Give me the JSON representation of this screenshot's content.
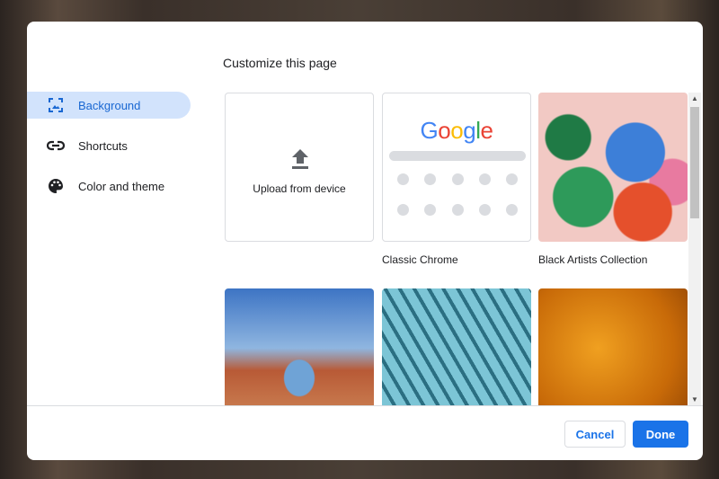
{
  "title": "Customize this page",
  "sidebar": {
    "items": [
      {
        "label": "Background",
        "icon": "image-icon",
        "active": true
      },
      {
        "label": "Shortcuts",
        "icon": "link-icon"
      },
      {
        "label": "Color and theme",
        "icon": "palette-icon"
      }
    ]
  },
  "tiles": {
    "upload": "Upload from device",
    "classic": "Classic Chrome",
    "google_logo": "Google",
    "black_artists": "Black Artists Collection"
  },
  "footer": {
    "cancel": "Cancel",
    "done": "Done"
  },
  "colors": {
    "accent": "#1a73e8",
    "active_bg": "#d2e3fc"
  }
}
